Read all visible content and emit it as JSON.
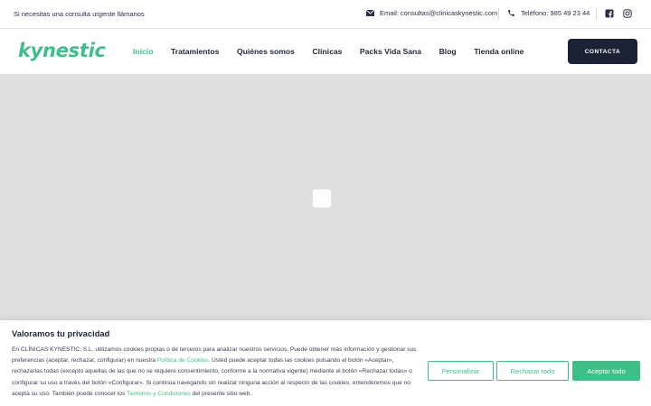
{
  "topbar": {
    "left_message": "Si necesitas una consulta urgente llámanos",
    "email": "Email: consultas@clinicaskynestic.com",
    "phone": "Teléfono: 985 49 23 44"
  },
  "icons": {
    "email": "mail-icon",
    "phone": "phone-icon",
    "facebook": "facebook-icon",
    "instagram": "instagram-icon"
  },
  "brand": {
    "logo_text": "kynestic",
    "accent_color": "#3dbf87",
    "dark_color": "#1c2235"
  },
  "nav": {
    "items": [
      {
        "label": "Inicio",
        "active": true
      },
      {
        "label": "Tratamientos",
        "active": false
      },
      {
        "label": "Quiénes somos",
        "active": false
      },
      {
        "label": "Clínicas",
        "active": false
      },
      {
        "label": "Packs Vida Sana",
        "active": false
      },
      {
        "label": "Blog",
        "active": false
      },
      {
        "label": "Tienda online",
        "active": false
      }
    ],
    "cta_label": "CONTACTA"
  },
  "cookie": {
    "title": "Valoramos tu privacidad",
    "text_1": "En CLÍNICAS KYNESTIC, S.L. utilizamos cookies propias o de terceros para analizar nuestros servicios. Puede obtener más información y gestionar sus preferencias (aceptar, rechazar, configurar) en nuestra ",
    "policy_link": "Política de Cookies",
    "text_2": ". Usted puede aceptar todas las cookies pulsando el botón «Aceptar», rechazarlas todas (excepto aquellas de las que no se requiere consentimiento, conforme a la normativa vigente) mediante el botón «Rechazar todas» o configurar su uso a través del botón «Configurar». Si continúa navegando sin realizar ninguna acción al respecto de las cookies, entenderemos que no acepta su uso. También puede conocer los ",
    "terms_link": "Términos y Condiciones",
    "text_3": " del presente sitio web.",
    "btn_customize": "Personalizar",
    "btn_reject": "Rechazar todo",
    "btn_accept": "Aceptar todo"
  }
}
